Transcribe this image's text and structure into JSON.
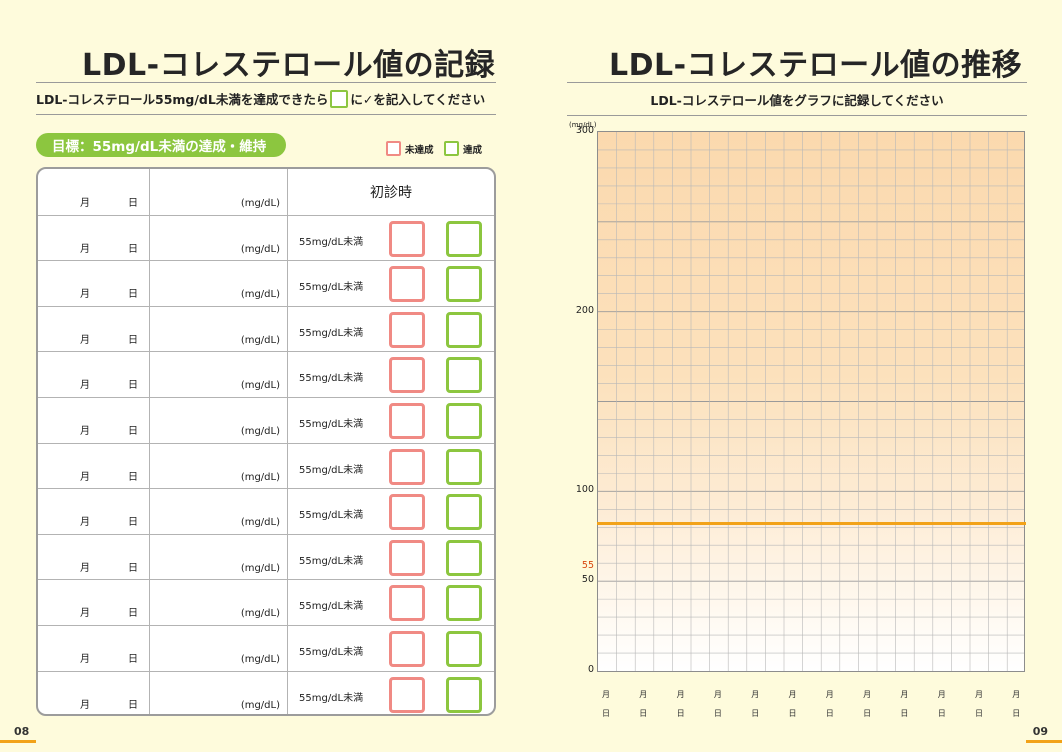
{
  "left_page": {
    "title": "LDL-コレステロール値の記録",
    "instruction_pre": "LDL-コレステロール55mg/dL未満を達成できたら",
    "instruction_post": "に✓を記入してください",
    "goal": "目標：55mg/dL未満の達成・維持",
    "legend": {
      "not_achieved": "未達成",
      "achieved": "達成"
    },
    "table": {
      "first_visit": "初診時",
      "month_label": "月",
      "day_label": "日",
      "unit_label": "(mg/dL)",
      "threshold_label": "55mg/dL未満",
      "rows": [
        1,
        2,
        3,
        4,
        5,
        6,
        7,
        8,
        9,
        10,
        11
      ]
    },
    "page_number": "08",
    "colors": {
      "not_achieved": "#f08a84",
      "achieved": "#8cc63f",
      "accent": "#f2a218"
    }
  },
  "right_page": {
    "title": "LDL-コレステロール値の推移",
    "subtitle": "LDL-コレステロール値をグラフに記録してください",
    "page_number": "09"
  },
  "chart_data": {
    "type": "line",
    "title": "LDL-コレステロール値の推移",
    "ylabel": "(mg/dL)",
    "ylim": [
      0,
      300
    ],
    "y_ticks": [
      0,
      50,
      100,
      200,
      300
    ],
    "reference_line": {
      "value": 55,
      "label": "55",
      "color": "#f2a218"
    },
    "x_slots": 11,
    "x_month_label": "月",
    "x_day_label": "日",
    "series": [],
    "grid": true
  }
}
